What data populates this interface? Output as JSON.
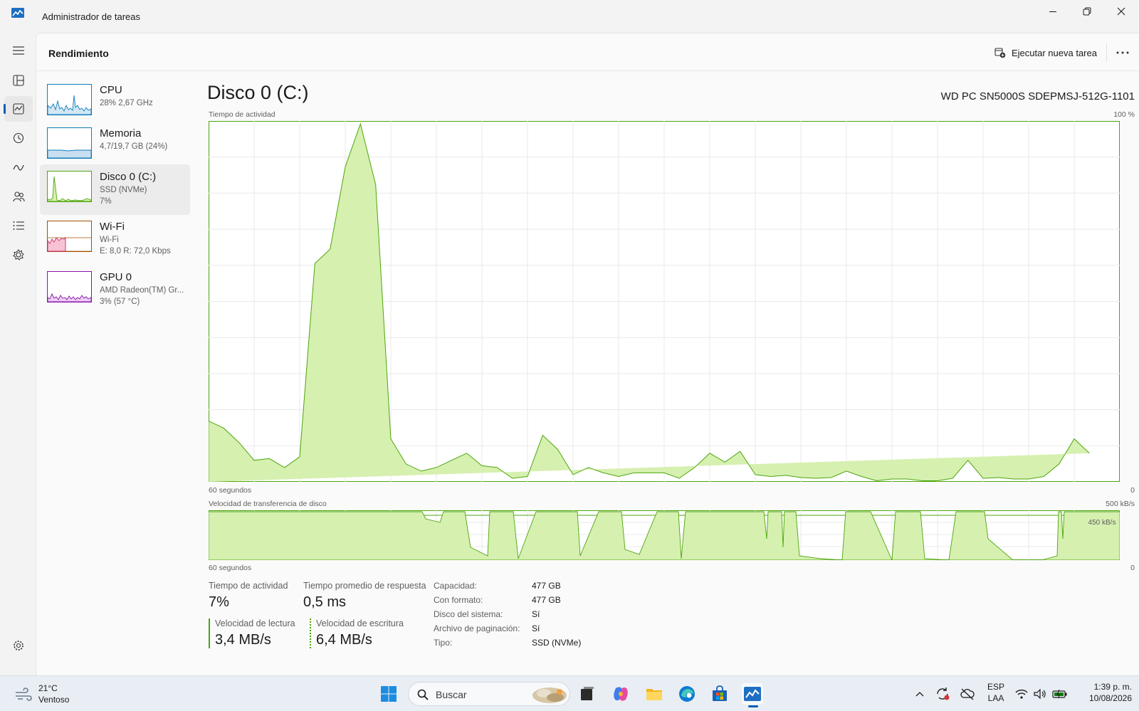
{
  "window": {
    "title": "Administrador de tareas"
  },
  "header": {
    "title": "Rendimiento",
    "run_task_label": "Ejecutar nueva tarea"
  },
  "colors": {
    "disk": "#4da60c",
    "disk_fill": "#d6f0b0",
    "cpu": "#117dbb",
    "memory": "#8b12ae",
    "wifi": "#a74f01",
    "gpu": "#8b12ae",
    "accent": "#005fb8"
  },
  "rail_icons": [
    "hamburger-icon",
    "processes-icon",
    "performance-icon",
    "app-history-icon",
    "startup-icon",
    "users-icon",
    "details-icon",
    "services-icon",
    "settings-icon"
  ],
  "devices": [
    {
      "name": "CPU",
      "line1": "28% 2,67 GHz",
      "line2": ""
    },
    {
      "name": "Memoria",
      "line1": "4,7/19,7 GB (24%)",
      "line2": ""
    },
    {
      "name": "Disco 0 (C:)",
      "line1": "SSD (NVMe)",
      "line2": "7%"
    },
    {
      "name": "Wi-Fi",
      "line1": "Wi-Fi",
      "line2": "E: 8,0 R: 72,0 Kbps"
    },
    {
      "name": "GPU 0",
      "line1": "AMD Radeon(TM) Gr...",
      "line2": "3% (57 °C)"
    }
  ],
  "disk": {
    "title": "Disco 0 (C:)",
    "model": "WD PC SN5000S SDEPMSJ-512G-1101",
    "activity_label": "Tiempo de actividad",
    "activity_max": "100 %",
    "time_left": "60 segundos",
    "time_right": "0",
    "transfer_label": "Velocidad de transferencia de disco",
    "transfer_max": "500 kB/s",
    "transfer_mark": "450 kB/s"
  },
  "stats": {
    "active_time_label": "Tiempo de actividad",
    "active_time_value": "7%",
    "response_label": "Tiempo promedio de respuesta",
    "response_value": "0,5 ms",
    "read_label": "Velocidad de lectura",
    "read_value": "3,4 MB/s",
    "write_label": "Velocidad de escritura",
    "write_value": "6,4 MB/s"
  },
  "properties": [
    {
      "key": "Capacidad:",
      "value": "477 GB"
    },
    {
      "key": "Con formato:",
      "value": "477 GB"
    },
    {
      "key": "Disco del sistema:",
      "value": "Sí"
    },
    {
      "key": "Archivo de paginación:",
      "value": "Sí"
    },
    {
      "key": "Tipo:",
      "value": "SSD (NVMe)"
    }
  ],
  "chart_data": {
    "type": "area",
    "title": "Tiempo de actividad",
    "x": [
      60,
      59,
      58,
      57,
      56,
      55,
      54,
      53,
      52,
      51,
      50,
      49,
      48,
      47,
      46,
      45,
      44,
      43,
      42,
      41,
      40,
      39,
      38,
      37,
      36,
      35,
      34,
      33,
      32,
      31,
      30,
      29,
      28,
      27,
      26,
      25,
      24,
      23,
      22,
      21,
      20,
      19,
      18,
      17,
      16,
      15,
      14,
      13,
      12,
      11,
      10,
      9,
      8,
      7,
      6,
      5,
      4,
      3,
      2,
      1,
      0
    ],
    "values": [
      17,
      15,
      11,
      6,
      6.5,
      4,
      7,
      61,
      65,
      88,
      100,
      83,
      12,
      5,
      3,
      4,
      6,
      8,
      4.5,
      4,
      1,
      1.5,
      13,
      9,
      2,
      4,
      2.5,
      1.5,
      2.5,
      2.5,
      2.5,
      1,
      4,
      8,
      5.5,
      8.5,
      2,
      1.5,
      1.8,
      1.2,
      1,
      1.2,
      3,
      1.5,
      0.3,
      0.8,
      0.8,
      0.3,
      0.3,
      1,
      6,
      1,
      1.2,
      0.8,
      0.8,
      1.5,
      5,
      12,
      8
    ],
    "ylim": [
      0,
      100
    ],
    "xlabel": "60 segundos",
    "ylabel": "Tiempo de actividad",
    "grid": true
  },
  "taskbar": {
    "weather_temp": "21°C",
    "weather_desc": "Ventoso",
    "search_placeholder": "Buscar",
    "lang1": "ESP",
    "lang2": "LAA",
    "time": "1:39 p. m.",
    "date": "10/08/2026"
  }
}
